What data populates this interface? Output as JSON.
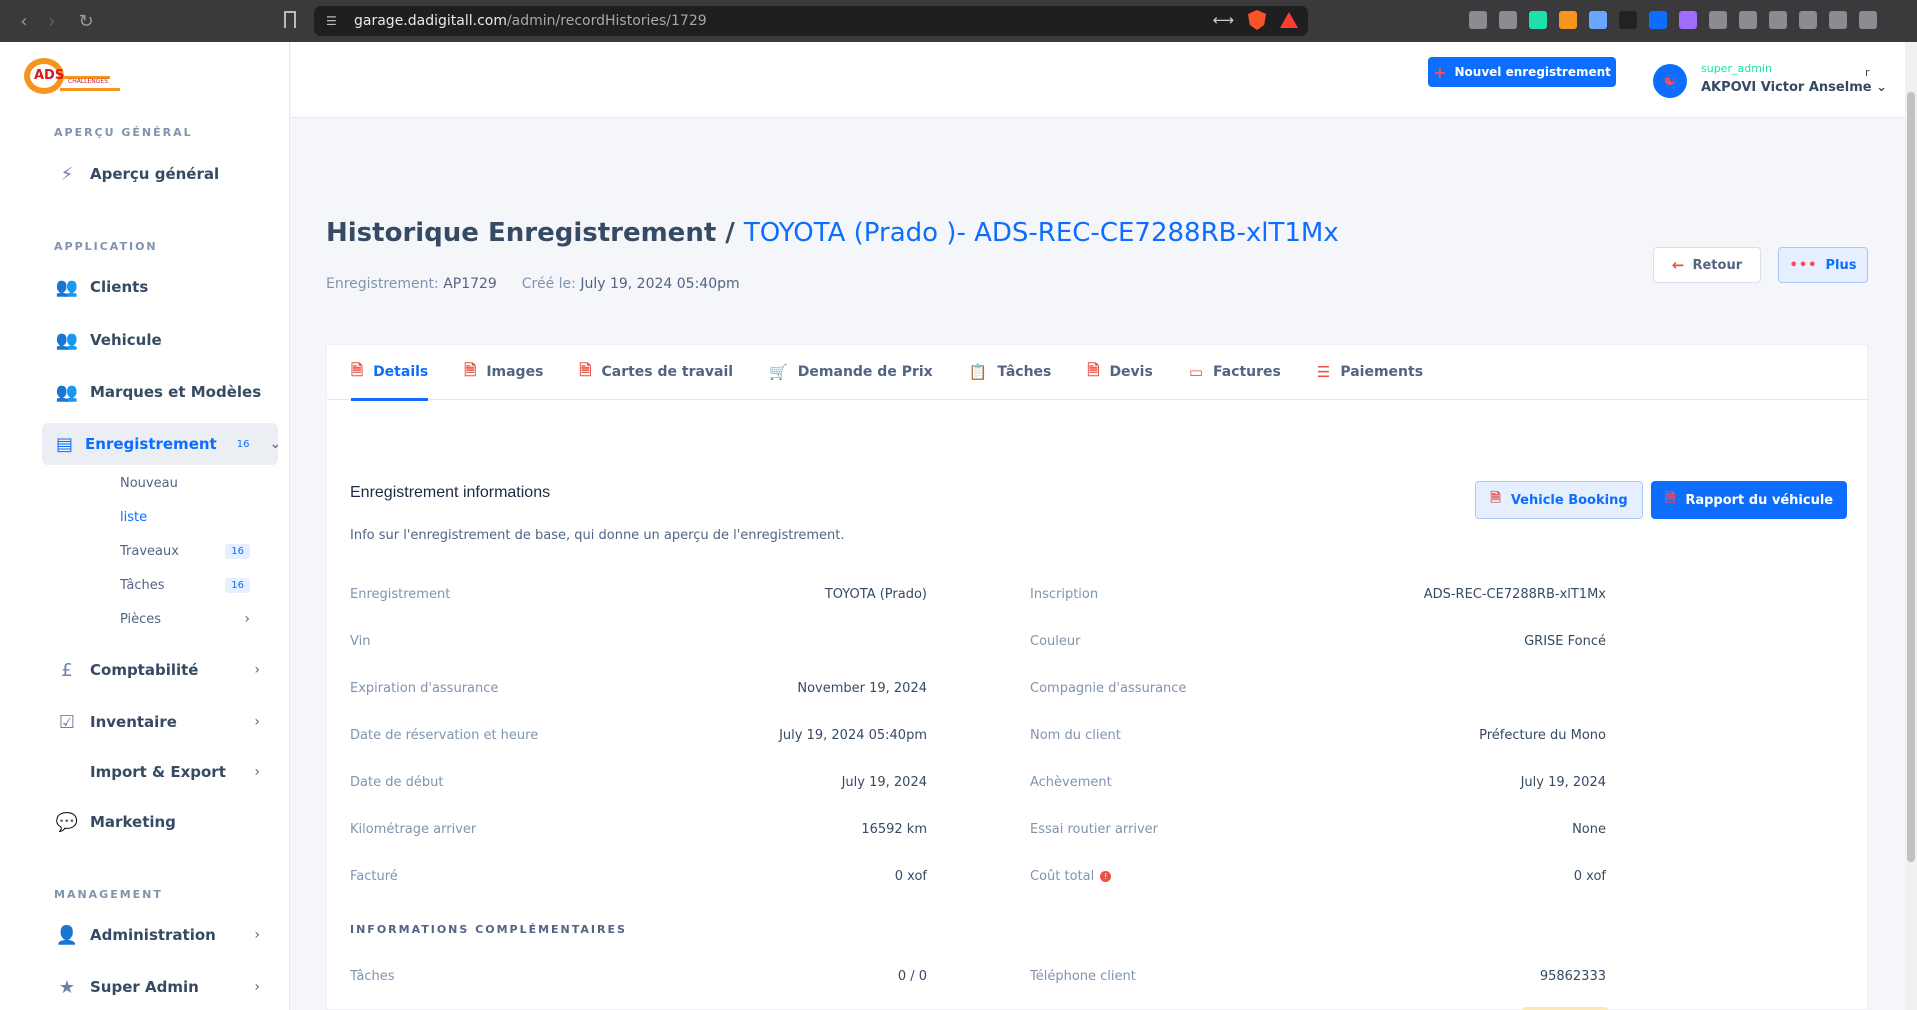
{
  "browser": {
    "url_host": "garage.dadigitall.com",
    "url_path": "/admin/recordHistories/1729"
  },
  "logo": {
    "text": "ADS",
    "sub": "CHALLENGES"
  },
  "sidebar": {
    "sections": {
      "overview": "APERÇU GÉNÉRAL",
      "application": "APPLICATION",
      "management": "MANAGEMENT"
    },
    "items": {
      "overview": "Aperçu général",
      "clients": "Clients",
      "vehicule": "Vehicule",
      "marques": "Marques et Modèles",
      "enregistrement": "Enregistrement",
      "enregistrement_badge": "16",
      "comptabilite": "Comptabilité",
      "inventaire": "Inventaire",
      "import_export": "Import & Export",
      "marketing": "Marketing",
      "administration": "Administration",
      "super_admin": "Super Admin"
    },
    "sub_items": {
      "nouveau": "Nouveau",
      "liste": "liste",
      "travaux": "Traveaux",
      "travaux_badge": "16",
      "taches": "Tâches",
      "taches_badge": "16",
      "pieces": "Pièces"
    }
  },
  "header": {
    "new_button": "Nouvel enregistrement",
    "user_role": "super_admin",
    "user_name": "AKPOVI Victor Anselme",
    "user_extra": "r"
  },
  "page": {
    "title": "Historique Enregistrement /",
    "title_accent": "TOYOTA (Prado )- ADS-REC-CE7288RB-xlT1Mx",
    "meta_record_label": "Enregistrement:",
    "meta_record_value": "AP1729",
    "meta_created_label": "Créé le:",
    "meta_created_value": "July 19, 2024 05:40pm",
    "back_button": "Retour",
    "more_button": "Plus"
  },
  "tabs": [
    {
      "label": "Details",
      "icon": "document-icon"
    },
    {
      "label": "Images",
      "icon": "image-icon"
    },
    {
      "label": "Cartes de travail",
      "icon": "card-icon"
    },
    {
      "label": "Demande de Prix",
      "icon": "cart-icon"
    },
    {
      "label": "Tâches",
      "icon": "task-icon"
    },
    {
      "label": "Devis",
      "icon": "quote-icon"
    },
    {
      "label": "Factures",
      "icon": "invoice-icon"
    },
    {
      "label": "Paiements",
      "icon": "list-icon"
    }
  ],
  "details": {
    "title": "Enregistrement informations",
    "description": "Info sur l'enregistrement de base, qui donne un aperçu de l'enregistrement.",
    "booking_button": "Vehicle Booking",
    "report_button": "Rapport du véhicule",
    "left": [
      {
        "label": "Enregistrement",
        "value": "TOYOTA (Prado)"
      },
      {
        "label": "Vin",
        "value": ""
      },
      {
        "label": "Expiration d'assurance",
        "value": "November 19, 2024"
      },
      {
        "label": "Date de réservation et heure",
        "value": "July 19, 2024 05:40pm"
      },
      {
        "label": "Date de début",
        "value": "July 19, 2024"
      },
      {
        "label": "Kilométrage arriver",
        "value": "16592 km"
      },
      {
        "label": "Facturé",
        "value": "0 xof"
      }
    ],
    "right": [
      {
        "label": "Inscription",
        "value": "ADS-REC-CE7288RB-xlT1Mx"
      },
      {
        "label": "Couleur",
        "value": "GRISE Foncé"
      },
      {
        "label": "Compagnie d'assurance",
        "value": ""
      },
      {
        "label": "Nom du client",
        "value": "Préfecture du Mono"
      },
      {
        "label": "Achèvement",
        "value": "July 19, 2024"
      },
      {
        "label": "Essai routier arriver",
        "value": "None"
      },
      {
        "label": "Coût total",
        "value": "0 xof"
      }
    ],
    "extra_title": "INFORMATIONS COMPLÉMENTAIRES",
    "extra_left": {
      "label": "Tâches",
      "value": "0 / 0"
    },
    "extra_right": {
      "label": "Téléphone client",
      "value": "95862333"
    }
  },
  "colors": {
    "accent": "#0d6efd",
    "danger": "#e85347",
    "success": "#1ee0ac"
  }
}
